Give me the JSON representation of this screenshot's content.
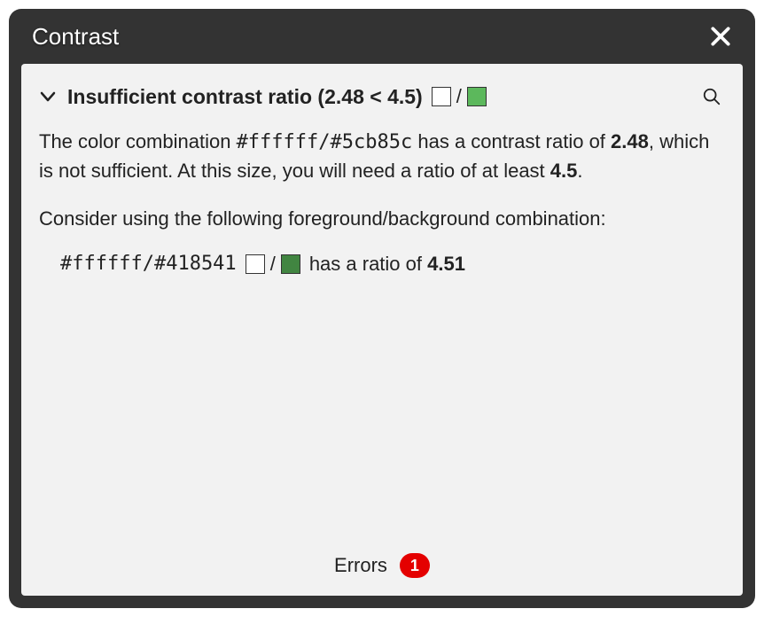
{
  "panel": {
    "title": "Contrast"
  },
  "issue": {
    "heading_prefix": "Insufficient contrast ratio (",
    "heading_ratio": "2.48 < 4.5",
    "heading_suffix": ")",
    "swatch_sep": "/",
    "fg_color": "#ffffff",
    "bg_color": "#5cb85c"
  },
  "description": {
    "line1_prefix": "The color combination ",
    "code1": "#ffffff",
    "slash": "/",
    "code2": "#5cb85c",
    "line1_mid": " has a contrast ratio of ",
    "ratio_actual": "2.48",
    "line1_mid2": ", which is not sufficient. At this size, you will need a ratio of at least ",
    "ratio_required": "4.5",
    "line1_end": ".",
    "line2": "Consider using the following foreground/background combination:"
  },
  "suggestion": {
    "code": "#ffffff/#418541",
    "fg_color": "#ffffff",
    "bg_color": "#418541",
    "swatch_sep": "/",
    "text_mid": " has a ratio of ",
    "ratio": "4.51"
  },
  "footer": {
    "label": "Errors",
    "count": "1"
  }
}
